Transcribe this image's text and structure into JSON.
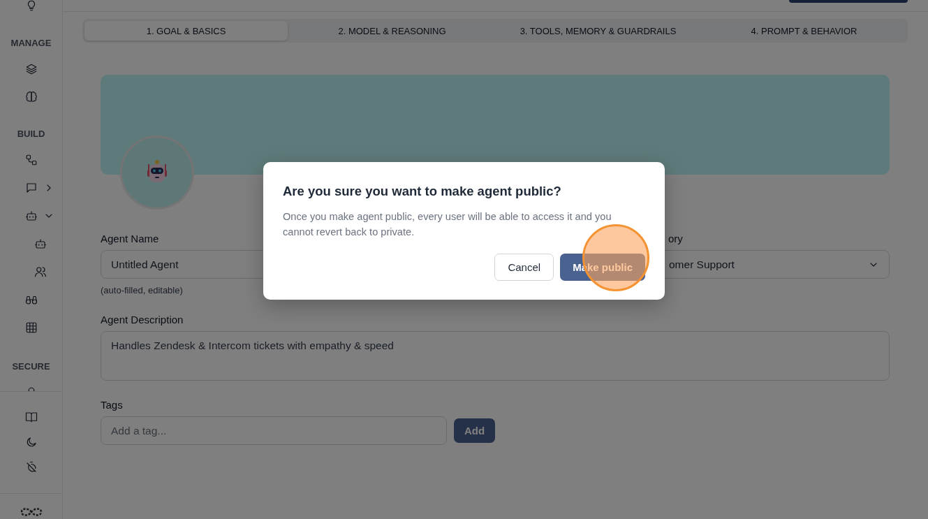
{
  "sidebar": {
    "sections": [
      {
        "label": "MANAGE"
      },
      {
        "label": "BUILD"
      },
      {
        "label": "SECURE"
      }
    ],
    "expandable_items": [
      {
        "expanded": false
      },
      {
        "expanded": true
      }
    ]
  },
  "tabs": [
    {
      "label": "1. GOAL & BASICS",
      "selected": true
    },
    {
      "label": "2. MODEL & REASONING",
      "selected": false
    },
    {
      "label": "3. TOOLS, MEMORY & GUARDRAILS",
      "selected": false
    },
    {
      "label": "4. PROMPT & BEHAVIOR",
      "selected": false
    }
  ],
  "form": {
    "agent_name": {
      "label": "Agent Name",
      "value": "Untitled Agent",
      "hint": "(auto-filled, editable)"
    },
    "category": {
      "label": "ory",
      "value": "omer Support"
    },
    "description": {
      "label": "Agent Description",
      "value": "Handles Zendesk & Intercom tickets with empathy & speed"
    },
    "tags": {
      "label": "Tags",
      "placeholder": "Add a tag...",
      "button": "Add"
    }
  },
  "dialog": {
    "title": "Are you sure you want to make agent public?",
    "message": "Once you make agent public, every user will be able to access it and you cannot revert back to private.",
    "buttons": [
      {
        "label": "Cancel",
        "kind": "secondary"
      },
      {
        "label": "Make public",
        "kind": "primary"
      }
    ]
  }
}
